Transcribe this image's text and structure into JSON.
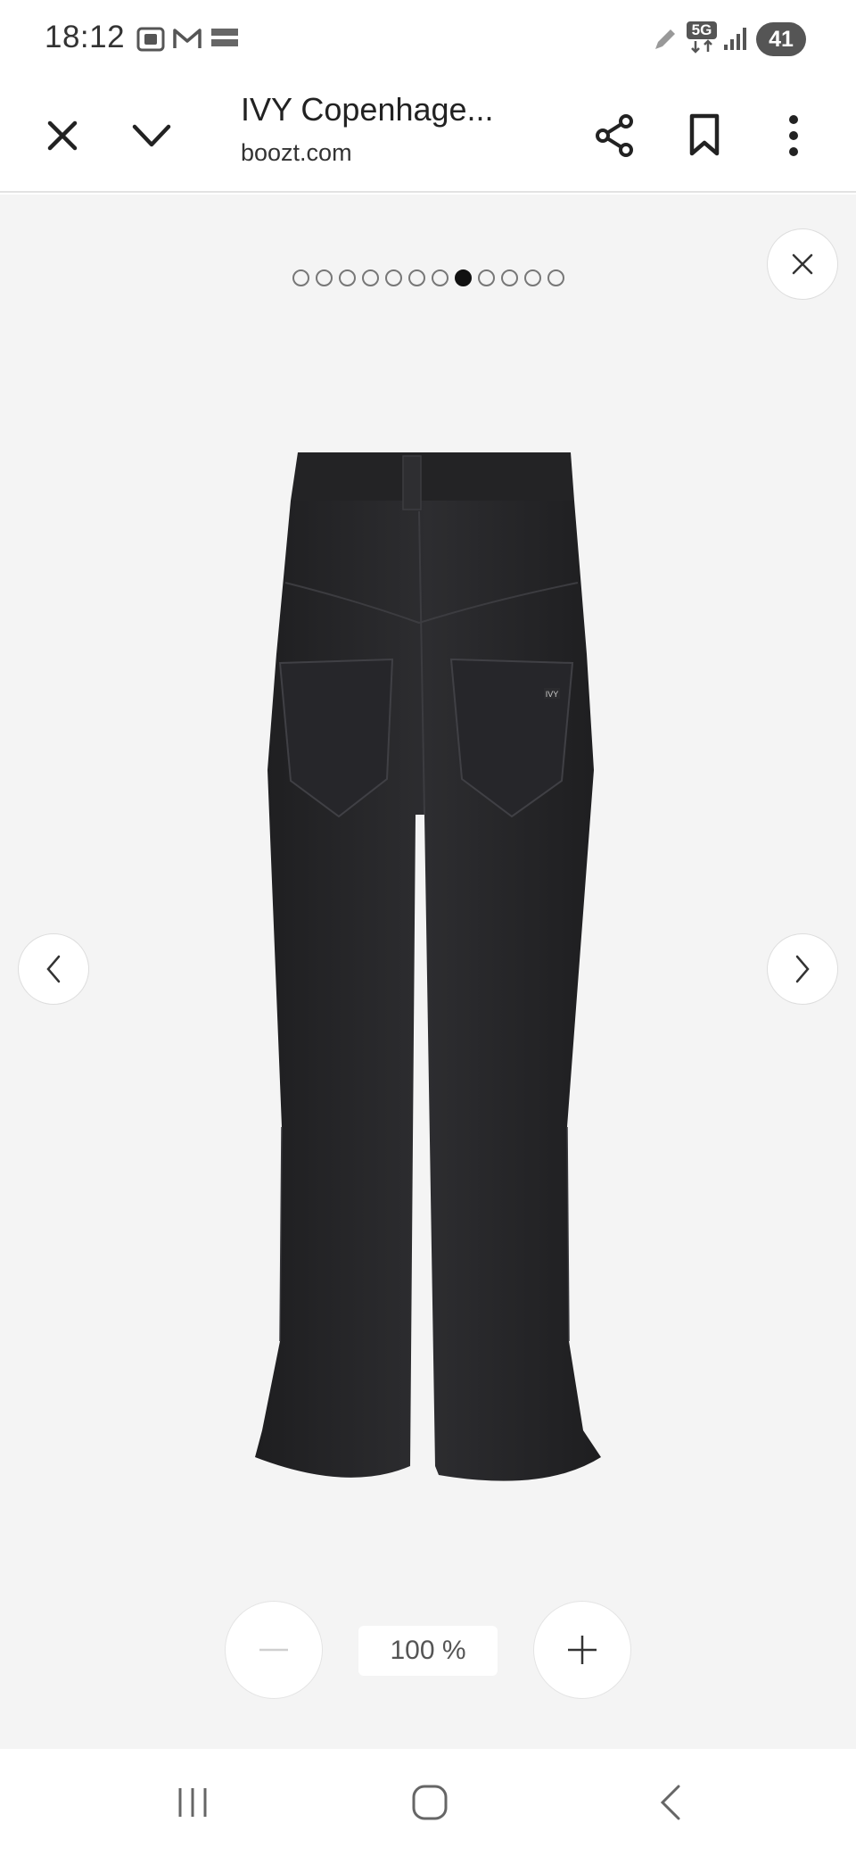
{
  "status_bar": {
    "time": "18:12",
    "network": "5G",
    "battery": "41",
    "icons": [
      "screenshot-icon",
      "gmail-icon",
      "temu-icon",
      "pen-icon",
      "network-5g-icon",
      "signal-icon",
      "battery-icon"
    ]
  },
  "toolbar": {
    "title": "IVY Copenhage...",
    "domain": "boozt.com",
    "icons": [
      "close-icon",
      "chevron-down-icon",
      "share-icon",
      "bookmark-icon",
      "more-vert-icon"
    ]
  },
  "gallery": {
    "total_images": 12,
    "active_index": 7,
    "image_description": "Black flared jeans, back view",
    "label_on_garment": "IVY"
  },
  "zoom": {
    "level": "100 %"
  },
  "colors": {
    "viewer_bg": "#f4f4f4",
    "active_dot": "#111111",
    "jeans": "#2a2a2c"
  }
}
